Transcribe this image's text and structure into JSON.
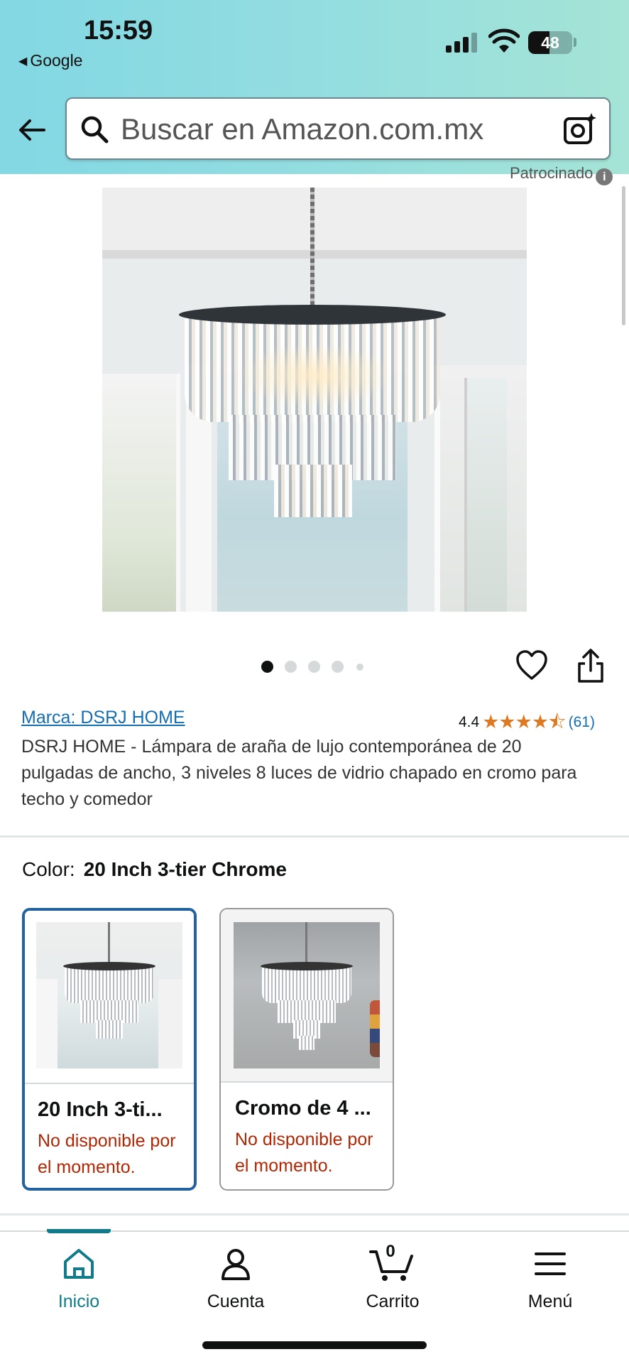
{
  "status_bar": {
    "time": "15:59",
    "back_app": "Google",
    "battery": "48",
    "battery_level_pct": 48
  },
  "search": {
    "placeholder": "Buscar en Amazon.com.mx",
    "icons": [
      "back-arrow-icon",
      "search-icon",
      "camera-search-icon"
    ]
  },
  "ad": {
    "sponsored_label": "Patrocinado",
    "info_glyph": "i"
  },
  "gallery": {
    "total_images": 5,
    "active_index": 0
  },
  "product": {
    "brand": "Marca: DSRJ HOME",
    "rating_value": "4.4",
    "stars_glyph": "★★★★⯪",
    "rating_count": "(61)",
    "title": "DSRJ HOME - Lámpara de araña de lujo contemporánea de 20 pulgadas de ancho, 3 niveles 8 luces de vidrio chapado en cromo para techo y comedor"
  },
  "variation": {
    "label": "Color:",
    "selected_value": "20 Inch 3-tier Chrome",
    "options": [
      {
        "name": "20 Inch 3-ti...",
        "status": "No disponible por el momento.",
        "selected": true
      },
      {
        "name": "Cromo de 4 ...",
        "status": "No disponible por el momento.",
        "selected": false
      }
    ]
  },
  "bottom_nav": {
    "items": [
      {
        "label": "Inicio",
        "icon": "home-icon",
        "active": true
      },
      {
        "label": "Cuenta",
        "icon": "account-icon",
        "active": false
      },
      {
        "label": "Carrito",
        "icon": "cart-icon",
        "active": false
      },
      {
        "label": "Menú",
        "icon": "menu-icon",
        "active": false
      }
    ],
    "cart_count": "0"
  },
  "colors": {
    "header_gradient_start": "#82d8e3",
    "header_gradient_end": "#a5e4d6",
    "link": "#146eb4",
    "star": "#de7921",
    "unavailable": "#b12704",
    "selected_border": "#2162a1",
    "nav_active": "#127b8a"
  }
}
